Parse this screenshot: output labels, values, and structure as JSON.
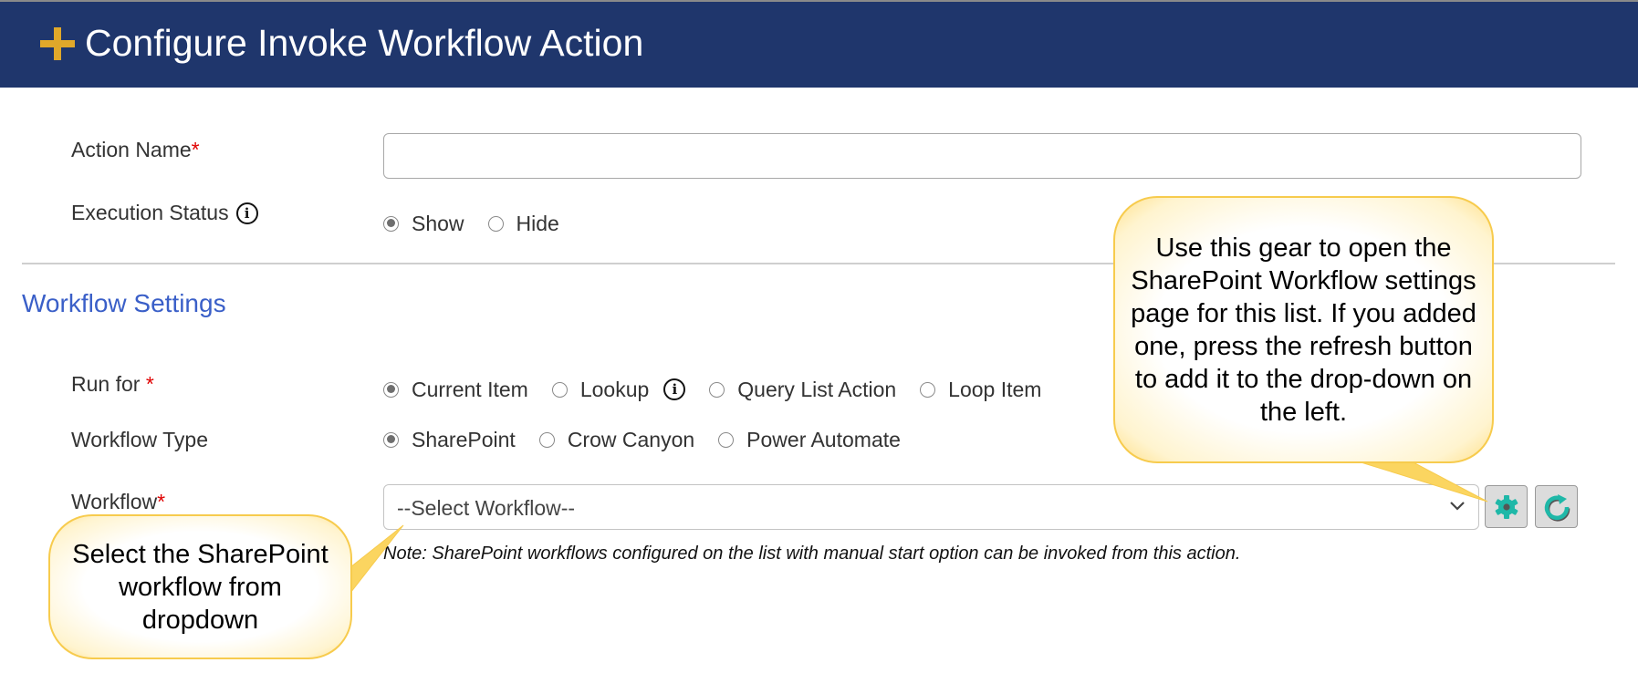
{
  "header": {
    "icon": "plus-icon",
    "title": "Configure Invoke Workflow Action"
  },
  "form": {
    "action_name": {
      "label": "Action Name",
      "required_mark": "*",
      "value": "",
      "placeholder": ""
    },
    "execution_status": {
      "label": "Execution Status",
      "info_icon": "info-icon",
      "info_glyph": "i",
      "options": [
        {
          "label": "Show",
          "checked": true
        },
        {
          "label": "Hide",
          "checked": false
        }
      ]
    }
  },
  "workflow_settings": {
    "title": "Workflow Settings",
    "run_for": {
      "label": "Run for ",
      "required_mark": "*",
      "options": [
        {
          "label": "Current Item",
          "checked": true
        },
        {
          "label": "Lookup",
          "checked": false,
          "info": true
        },
        {
          "label": "Query List Action",
          "checked": false
        },
        {
          "label": "Loop Item",
          "checked": false
        }
      ]
    },
    "workflow_type": {
      "label": "Workflow Type",
      "options": [
        {
          "label": "SharePoint",
          "checked": true
        },
        {
          "label": "Crow Canyon",
          "checked": false
        },
        {
          "label": "Power Automate",
          "checked": false
        }
      ]
    },
    "workflow": {
      "label": "Workflow",
      "required_mark": "*",
      "selected": "--Select Workflow--",
      "gear_button_icon": "gear-icon",
      "refresh_button_icon": "refresh-icon",
      "note": "Note: SharePoint workflows configured on the list with manual start option can be invoked from this action."
    }
  },
  "callouts": {
    "right": "Use this gear to open the SharePoint Workflow settings page for this list. If you added one, press the refresh button to add it to the drop-down on the left.",
    "left": "Select the SharePoint workflow from dropdown"
  },
  "colors": {
    "header_bg": "#1f366c",
    "plus_icon": "#e0a82a",
    "section_title": "#3a5fc8",
    "required": "#e00000",
    "icon_teal": "#1fb8a8",
    "callout_border": "#f7cb4d"
  }
}
